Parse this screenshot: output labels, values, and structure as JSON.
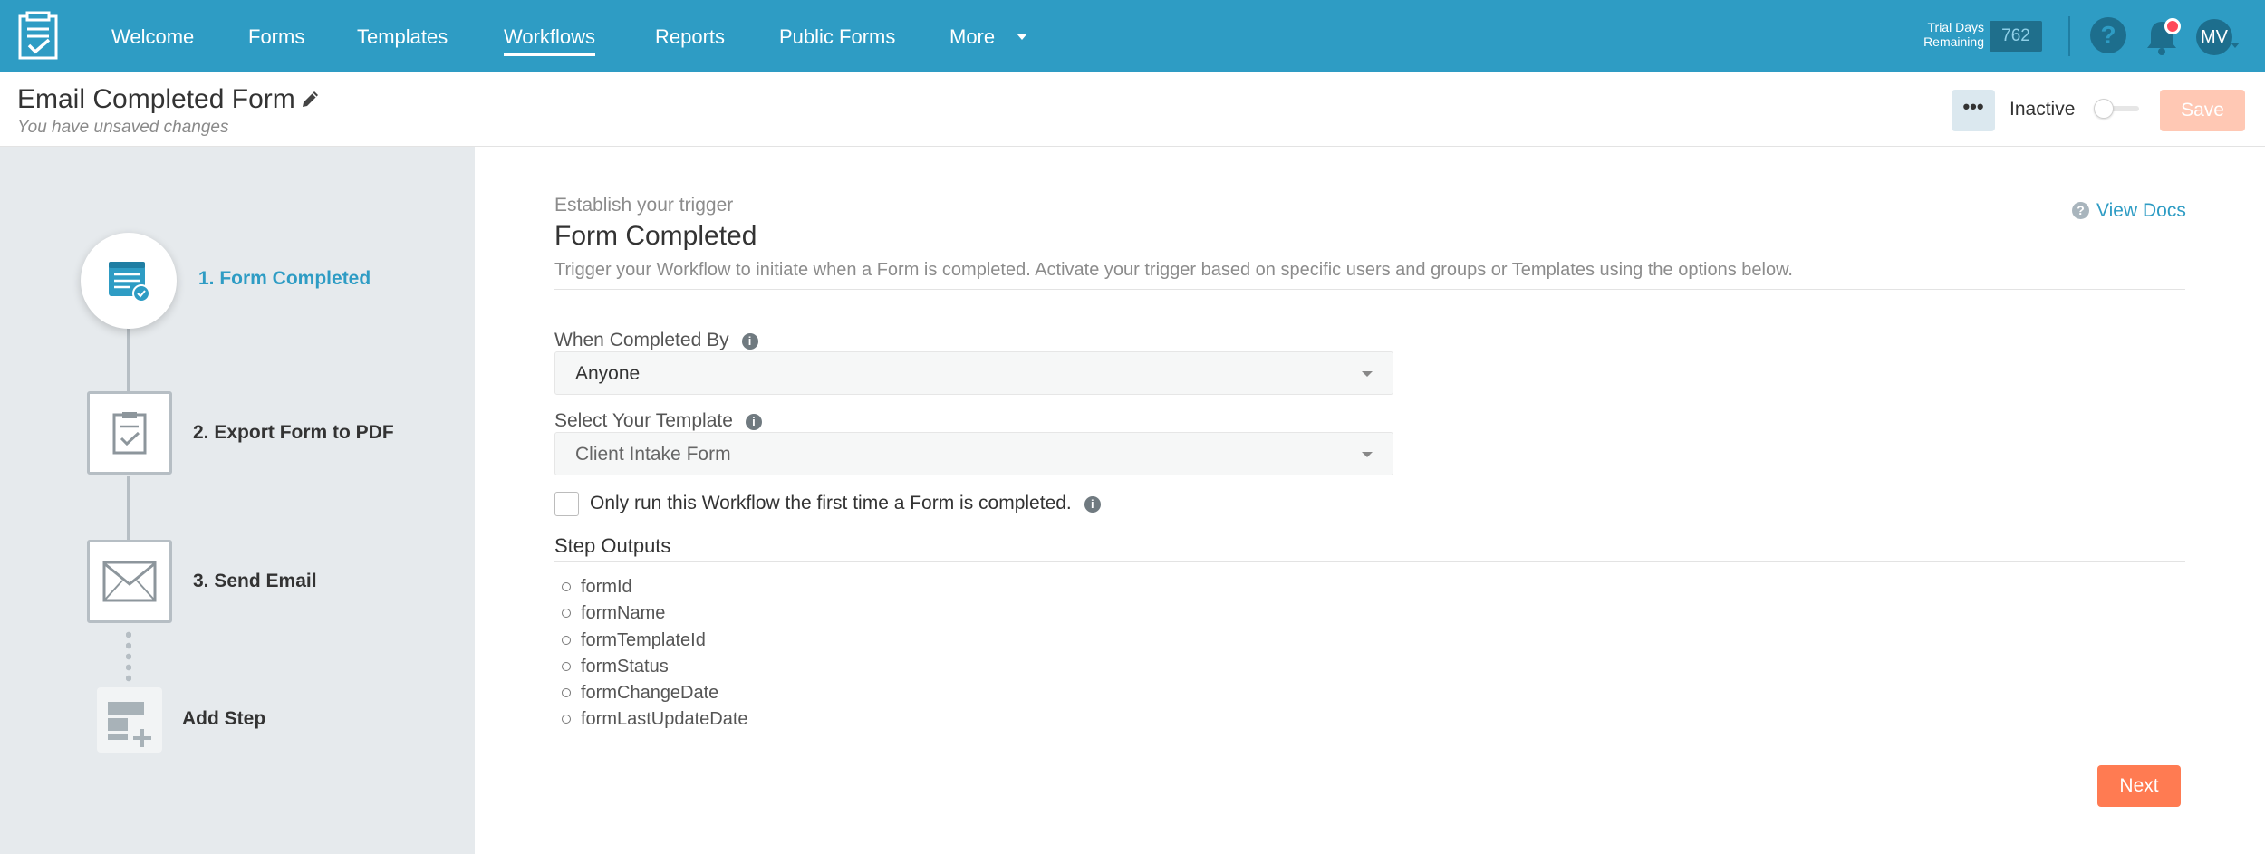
{
  "topnav": {
    "items": [
      "Welcome",
      "Forms",
      "Templates",
      "Workflows",
      "Reports",
      "Public Forms",
      "More"
    ],
    "active": "Workflows",
    "trial_label_line1": "Trial Days",
    "trial_label_line2": "Remaining",
    "trial_days": "762",
    "avatar_initials": "MV",
    "help_glyph": "?"
  },
  "header": {
    "title": "Email Completed Form",
    "unsaved": "You have unsaved changes",
    "more_glyph": "•••",
    "status_label": "Inactive",
    "save_label": "Save"
  },
  "steps": {
    "items": [
      {
        "label": "1. Form Completed",
        "icon": "form-completed-icon",
        "active": true
      },
      {
        "label": "2. Export Form to PDF",
        "icon": "pdf-export-icon",
        "active": false
      },
      {
        "label": "3. Send Email",
        "icon": "envelope-icon",
        "active": false
      }
    ],
    "add_step": "Add Step"
  },
  "main": {
    "eyebrow": "Establish your trigger",
    "title": "Form Completed",
    "description": "Trigger your Workflow to initiate when a Form is completed. Activate your trigger based on specific users and groups or Templates using the options below.",
    "view_docs": "View Docs",
    "completed_by_label": "When Completed By",
    "completed_by_value": "Anyone",
    "template_label": "Select Your Template",
    "template_value": "Client Intake Form",
    "first_time_label": "Only run this Workflow the first time a Form is completed.",
    "first_time_checked": false,
    "outputs_title": "Step Outputs",
    "outputs": [
      "formId",
      "formName",
      "formTemplateId",
      "formStatus",
      "formChangeDate",
      "formLastUpdateDate"
    ],
    "next_label": "Next"
  },
  "colors": {
    "brand": "#2e9cc4",
    "next": "#ff7b52",
    "save_disabled": "#ffc8b4",
    "notification": "#ff4a5a"
  }
}
